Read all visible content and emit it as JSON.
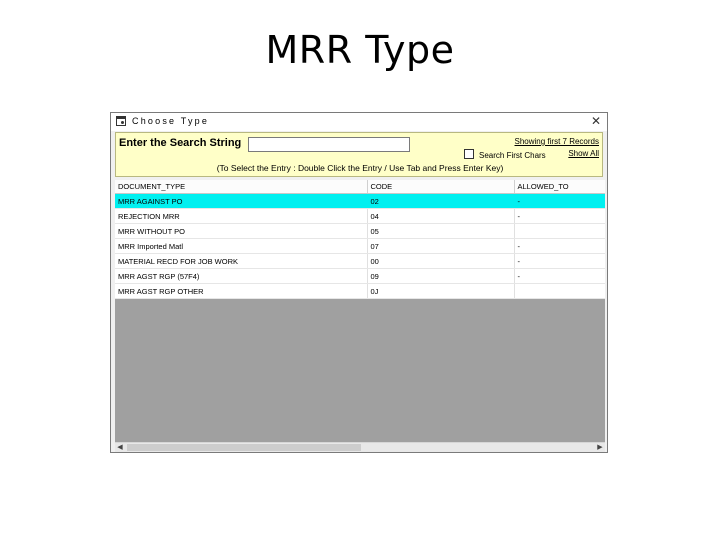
{
  "slide": {
    "title": "MRR Type"
  },
  "window": {
    "title": "Choose Type",
    "app_icon": "window-icon",
    "close_symbol": "✕"
  },
  "search": {
    "label": "Enter the Search String",
    "value": "",
    "placeholder": "",
    "showing_text": "Showing first 7 Records",
    "first_chars_label": "Search First Chars",
    "first_chars_checked": false,
    "show_all_label": "Show All",
    "hint": "(To Select the Entry : Double Click the Entry / Use Tab and Press Enter Key)"
  },
  "table": {
    "columns": [
      "DOCUMENT_TYPE",
      "CODE",
      "ALLOWED_TO"
    ],
    "rows": [
      [
        "MRR AGAINST PO",
        "02",
        "-"
      ],
      [
        "REJECTION MRR",
        "04",
        "-"
      ],
      [
        "MRR WITHOUT PO",
        "05",
        ""
      ],
      [
        "MRR Imported Matl",
        "07",
        "-"
      ],
      [
        "MATERIAL RECD FOR JOB WORK",
        "00",
        "-"
      ],
      [
        "MRR AGST RGP (57F4)",
        "09",
        "-"
      ],
      [
        "MRR AGST RGP OTHER",
        "0J",
        ""
      ]
    ],
    "selected_row": 0,
    "selected_color": "#00f0f0"
  },
  "colors": {
    "search_panel_bg": "#ffffc8",
    "grid_empty_bg": "#a0a0a0"
  }
}
